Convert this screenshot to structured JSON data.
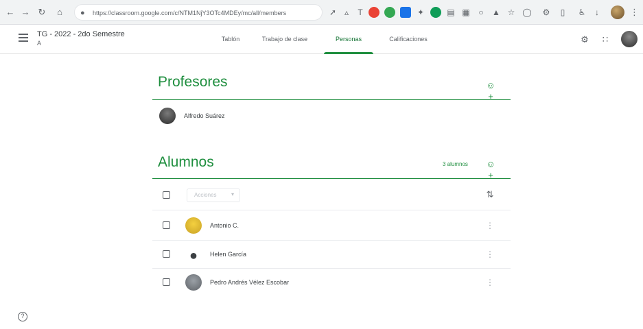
{
  "browser": {
    "back_icon": "arrow-left-icon",
    "forward_icon": "arrow-right-icon",
    "reload_icon": "reload-icon",
    "home_icon": "home-icon",
    "url": "https://classroom.google.com/c/NTM1NjY3OTc4MDEy/mc/all/members",
    "ext_colors": [
      "#ea4335",
      "#34a853",
      "#1a73e8",
      "#0f9d58",
      "#ea4335"
    ]
  },
  "header": {
    "class_title": "TG - 2022 - 2do Semestre",
    "class_subtitle": "A",
    "tabs": [
      {
        "label": "Tablón"
      },
      {
        "label": "Trabajo de clase"
      },
      {
        "label": "Personas"
      },
      {
        "label": "Calificaciones"
      }
    ],
    "active_tab": "Personas"
  },
  "teachers": {
    "title": "Profesores",
    "members": [
      {
        "name": "Alfredo Suárez"
      }
    ]
  },
  "students": {
    "title": "Alumnos",
    "count_label": "3 alumnos",
    "actions_label": "Acciones",
    "members": [
      {
        "name": "Antonio C."
      },
      {
        "name": "Helen García"
      },
      {
        "name": "Pedro Andrés Vélez Escobar"
      }
    ]
  },
  "colors": {
    "accent": "#1e8e3e",
    "text": "#3c4043",
    "muted": "#5f6368"
  }
}
